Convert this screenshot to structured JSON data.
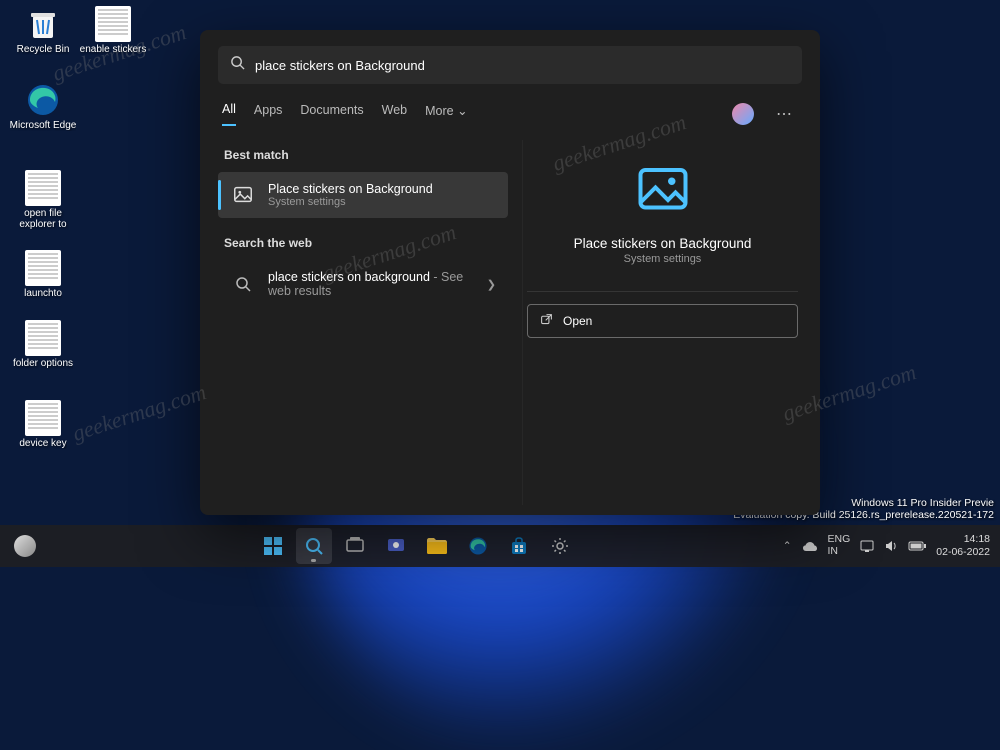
{
  "desktop": {
    "icons": [
      {
        "id": "recycle-bin",
        "label": "Recycle Bin"
      },
      {
        "id": "enable-stickers",
        "label": "enable stickers"
      },
      {
        "id": "ms-edge",
        "label": "Microsoft Edge"
      },
      {
        "id": "open-file-explorer",
        "label": "open file explorer to"
      },
      {
        "id": "launchto",
        "label": "launchto"
      },
      {
        "id": "folder-options",
        "label": "folder options"
      },
      {
        "id": "device-key",
        "label": "device key"
      }
    ]
  },
  "search": {
    "query": "place stickers on Background",
    "tabs": [
      "All",
      "Apps",
      "Documents",
      "Web",
      "More"
    ],
    "active_tab": "All",
    "more_caret": "⌄",
    "section_best": "Best match",
    "section_web": "Search the web",
    "best_match": {
      "title": "Place stickers on Background",
      "subtitle": "System settings"
    },
    "web_result": {
      "title_main": "place stickers on background",
      "title_suffix": " - See web results"
    },
    "preview": {
      "title": "Place stickers on Background",
      "subtitle": "System settings",
      "open_label": "Open"
    }
  },
  "system_status": {
    "line1": "Windows 11 Pro Insider Previe",
    "line2": "Evaluation copy. Build 25126.rs_prerelease.220521-172"
  },
  "taskbar": {
    "tray": {
      "up": "⌃",
      "cloud": "☁"
    },
    "lang": {
      "l1": "ENG",
      "l2": "IN"
    },
    "icons_right_labels": [
      "network",
      "volume",
      "battery"
    ],
    "time": "14:18",
    "date": "02-06-2022"
  },
  "watermark": "geekermag.com",
  "colors": {
    "accent": "#4cc2ff"
  }
}
